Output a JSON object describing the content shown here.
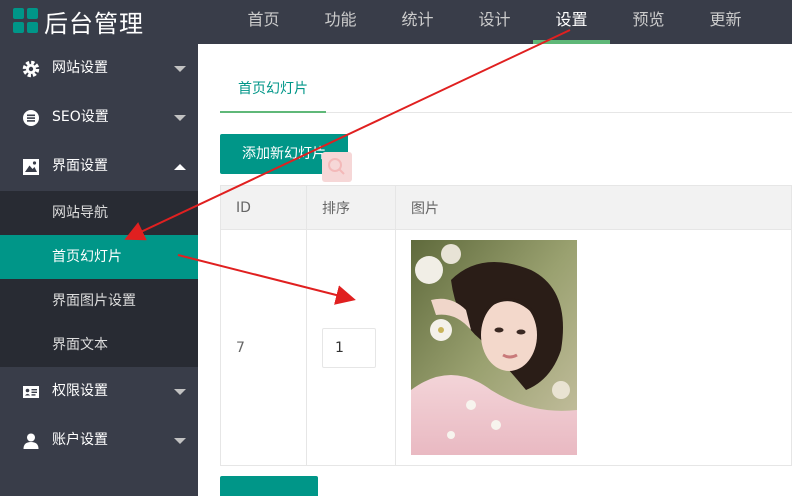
{
  "app": {
    "title": "后台管理"
  },
  "nav": {
    "items": [
      "首页",
      "功能",
      "统计",
      "设计",
      "设置",
      "预览",
      "更新"
    ],
    "active_index": 4
  },
  "sidebar": {
    "groups": [
      {
        "label": "网站设置",
        "icon": "gear-icon",
        "expanded": false
      },
      {
        "label": "SEO设置",
        "icon": "list-circle-icon",
        "expanded": false
      },
      {
        "label": "界面设置",
        "icon": "picture-icon",
        "expanded": true,
        "items": [
          "网站导航",
          "首页幻灯片",
          "界面图片设置",
          "界面文本"
        ],
        "active_item": 1
      },
      {
        "label": "权限设置",
        "icon": "id-card-icon",
        "expanded": false
      },
      {
        "label": "账户设置",
        "icon": "user-icon",
        "expanded": false
      }
    ]
  },
  "main": {
    "tab": "首页幻灯片",
    "add_button": "添加新幻灯片",
    "table": {
      "headers": [
        "ID",
        "排序",
        "图片"
      ],
      "rows": [
        {
          "id": "7",
          "sort": "1",
          "image": "woman-lying-among-flowers"
        }
      ]
    }
  },
  "colors": {
    "header_bg": "#393d49",
    "sidebar_bg": "#393d49",
    "submenu_bg": "#282b33",
    "accent": "#009688",
    "active_underline": "#5fb878",
    "annotation_arrow": "#e02020"
  }
}
